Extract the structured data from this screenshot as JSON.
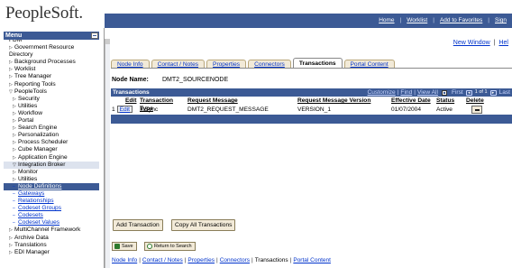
{
  "header": {
    "logo": "PeopleSoft.",
    "links": [
      "Home",
      "Worklist",
      "Add to Favorites",
      "Sign"
    ]
  },
  "toolbar": {
    "new_window": "New Window",
    "help": "Hel"
  },
  "menu": {
    "title": "Menu",
    "items": [
      {
        "label": "FDM",
        "level": "cont"
      },
      {
        "label": "Government Resource",
        "level": "l1",
        "glyph": "▷"
      },
      {
        "label": "Directory",
        "level": "cont"
      },
      {
        "label": "Background Processes",
        "level": "l1",
        "glyph": "▷"
      },
      {
        "label": "Worklist",
        "level": "l1",
        "glyph": "▷"
      },
      {
        "label": "Tree Manager",
        "level": "l1",
        "glyph": "▷"
      },
      {
        "label": "Reporting Tools",
        "level": "l1",
        "glyph": "▷"
      },
      {
        "label": "PeopleTools",
        "level": "l1",
        "glyph": "▽"
      },
      {
        "label": "Security",
        "level": "l2",
        "glyph": "▷"
      },
      {
        "label": "Utilities",
        "level": "l2",
        "glyph": "▷"
      },
      {
        "label": "Workflow",
        "level": "l2",
        "glyph": "▷"
      },
      {
        "label": "Portal",
        "level": "l2",
        "glyph": "▷"
      },
      {
        "label": "Search Engine",
        "level": "l2",
        "glyph": "▷"
      },
      {
        "label": "Personalization",
        "level": "l2",
        "glyph": "▷"
      },
      {
        "label": "Process Scheduler",
        "level": "l2",
        "glyph": "▷"
      },
      {
        "label": "Cube Manager",
        "level": "l2",
        "glyph": "▷"
      },
      {
        "label": "Application Engine",
        "level": "l2",
        "glyph": "▷"
      },
      {
        "label": "Integration Broker",
        "level": "l2 ib",
        "glyph": "▽"
      },
      {
        "label": "Monitor",
        "level": "l2",
        "glyph": "▷"
      },
      {
        "label": "Utilities",
        "level": "l2",
        "glyph": "▷"
      },
      {
        "label": "Node Definitions",
        "level": "l3 sel",
        "glyph": "–"
      },
      {
        "label": "Gateways",
        "level": "l3",
        "glyph": "–"
      },
      {
        "label": "Relationships",
        "level": "l3",
        "glyph": "–"
      },
      {
        "label": "Codeset Groups",
        "level": "l3",
        "glyph": "–"
      },
      {
        "label": "Codesets",
        "level": "l3",
        "glyph": "–"
      },
      {
        "label": "Codeset Values",
        "level": "l3",
        "glyph": "–"
      },
      {
        "label": "MultiChannel Framework",
        "level": "l1",
        "glyph": "▷"
      },
      {
        "label": "Archive Data",
        "level": "l1",
        "glyph": "▷"
      },
      {
        "label": "Translations",
        "level": "l1",
        "glyph": "▷"
      },
      {
        "label": "EDI Manager",
        "level": "l1",
        "glyph": "▷"
      }
    ]
  },
  "tabs": [
    {
      "label": "Node Info",
      "active": false
    },
    {
      "label": "Contact / Notes",
      "active": false
    },
    {
      "label": "Properties",
      "active": false
    },
    {
      "label": "Connectors",
      "active": false
    },
    {
      "label": "Transactions",
      "active": true
    },
    {
      "label": "Portal Content",
      "active": false
    }
  ],
  "node": {
    "label": "Node Name:",
    "value": "DMT2_SOURCENODE"
  },
  "grid": {
    "title": "Transactions",
    "customize": "Customize",
    "find": "Find",
    "view_all": "View All",
    "first": "First",
    "range": "1 of 1",
    "last": "Last",
    "columns": [
      "Edit",
      "Transaction Type",
      "Request Message",
      "Request Message Version",
      "Effective Date",
      "Status",
      "Delete"
    ],
    "rows": [
      {
        "num": "1",
        "edit": "Edit",
        "type": "InSync",
        "message": "DMT2_REQUEST_MESSAGE",
        "version": "VERSION_1",
        "date": "01/07/2004",
        "status": "Active"
      }
    ]
  },
  "buttons": {
    "add_transaction": "Add Transaction",
    "copy_all": "Copy All Transactions",
    "save": "Save",
    "return_to_search": "Return to Search"
  },
  "bottom_links": [
    "Node Info",
    "Contact / Notes",
    "Properties",
    "Connectors",
    "Transactions",
    "Portal Content"
  ],
  "colors": {
    "accent": "#3c5a95",
    "link": "#0033cc",
    "tab_bg": "#f2ead8"
  }
}
